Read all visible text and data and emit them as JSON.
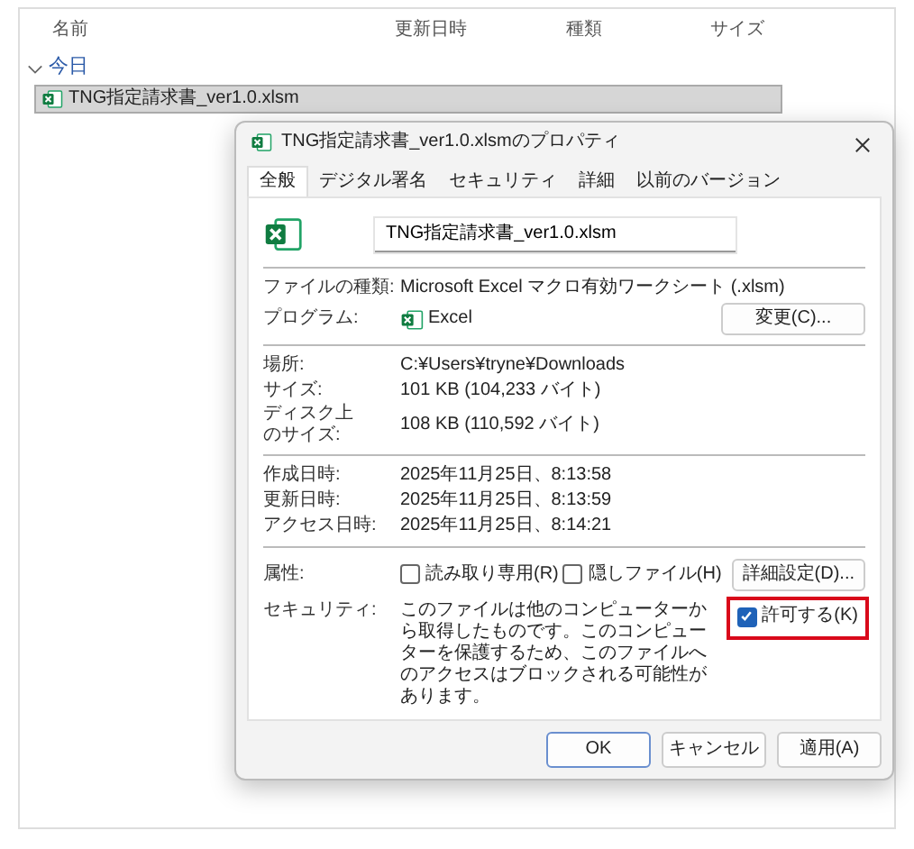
{
  "explorer": {
    "columns": [
      "名前",
      "更新日時",
      "種類",
      "サイズ"
    ],
    "group": {
      "label": "今日",
      "expanded": true
    },
    "files": [
      {
        "name": "TNG指定請求書_ver1.0.xlsm",
        "selected": true
      }
    ]
  },
  "dialog": {
    "title": "TNG指定請求書_ver1.0.xlsmのプロパティ",
    "tabs": [
      {
        "label": "全般",
        "selected": true
      },
      {
        "label": "デジタル署名",
        "selected": false
      },
      {
        "label": "セキュリティ",
        "selected": false
      },
      {
        "label": "詳細",
        "selected": false
      },
      {
        "label": "以前のバージョン",
        "selected": false
      }
    ],
    "file_name": "TNG指定請求書_ver1.0.xlsm",
    "sections": [
      [
        {
          "kind": "text",
          "label": [
            "ファイルの種類:"
          ],
          "value": "Microsoft Excel マクロ有効ワークシート (.xlsm)"
        },
        {
          "kind": "program",
          "label": [
            "プログラム:"
          ],
          "value": "Excel",
          "button": "変更(C)..."
        }
      ],
      [
        {
          "kind": "text",
          "label": [
            "場所:"
          ],
          "value": "C:¥Users¥tryne¥Downloads"
        },
        {
          "kind": "text",
          "label": [
            "サイズ:"
          ],
          "value": "101 KB (104,233 バイト)"
        },
        {
          "kind": "text",
          "label": [
            "ディスク上",
            "のサイズ:"
          ],
          "value": "108 KB (110,592 バイト)"
        }
      ],
      [
        {
          "kind": "text",
          "label": [
            "作成日時:"
          ],
          "value": "2025年11月25日、8:13:58"
        },
        {
          "kind": "text",
          "label": [
            "更新日時:"
          ],
          "value": "2025年11月25日、8:13:59"
        },
        {
          "kind": "text",
          "label": [
            "アクセス日時:"
          ],
          "value": "2025年11月25日、8:14:21"
        }
      ],
      [
        {
          "kind": "attributes",
          "label": [
            "属性:"
          ],
          "checkboxes": [
            {
              "label": "読み取り専用(R)",
              "checked": false
            },
            {
              "label": "隠しファイル(H)",
              "checked": false
            }
          ],
          "button": "詳細設定(D)..."
        },
        {
          "kind": "security",
          "label": [
            "セキュリティ:"
          ],
          "value": "このファイルは他のコンピューターから取得したものです。このコンピューターを保護するため、このファイルへのアクセスはブロックされる可能性があります。",
          "checkbox": {
            "label": "許可する(K)",
            "checked": true,
            "highlighted": true
          }
        }
      ]
    ],
    "buttons": [
      {
        "label": "OK",
        "default": true
      },
      {
        "label": "キャンセル",
        "default": false
      },
      {
        "label": "適用(A)",
        "default": false
      }
    ]
  }
}
